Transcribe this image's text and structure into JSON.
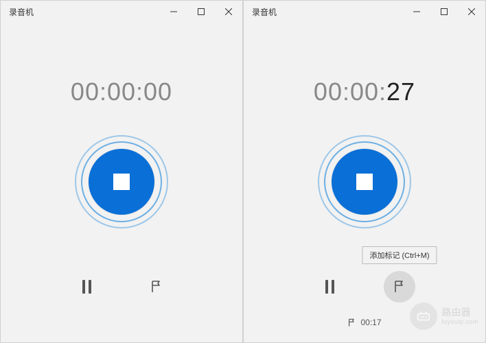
{
  "left": {
    "title": "录音机",
    "timer_inactive": "00:00:00",
    "timer_active": ""
  },
  "right": {
    "title": "录音机",
    "timer_inactive": "00:00:",
    "timer_active": "27",
    "tooltip": "添加标记 (Ctrl+M)",
    "marker_time": "00:17"
  },
  "watermark": {
    "line1": "路由器",
    "line2": "luyouqi.com"
  }
}
